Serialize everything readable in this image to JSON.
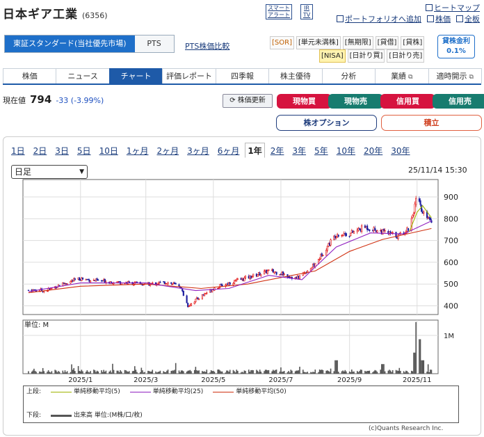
{
  "header": {
    "company_name": "日本ギア工業",
    "code": "(6356)",
    "smart_alert_1": "スマート",
    "smart_alert_2": "アラート",
    "ir_1": "IR",
    "ir_2": "TV",
    "heatmap": "ヒートマップ",
    "portfolio_add": "ポートフォリオへ追加",
    "stock_price": "株価",
    "full_board": "全板"
  },
  "market_tabs": [
    "東証スタンダード(当社優先市場)",
    "PTS"
  ],
  "pts_compare": "PTS株価比較",
  "tags_row1": [
    "[SOR]",
    "[単元未満株]",
    "[無期限]",
    "[貸借]",
    "[貸株]"
  ],
  "tags_row2": [
    "[NISA]",
    "[日計り買]",
    "[日計り売]"
  ],
  "lending": {
    "label": "貸株金利",
    "rate": "0.1%"
  },
  "nav": [
    "株価",
    "ニュース",
    "チャート",
    "評価レポート",
    "四季報",
    "株主優待",
    "分析",
    "業績",
    "適時開示"
  ],
  "price": {
    "label": "現在値",
    "value": "794",
    "change": "-33 (-3.99%)"
  },
  "buttons": {
    "refresh": "株価更新",
    "buy": "現物買",
    "sell": "現物売",
    "margin_buy": "信用買",
    "margin_sell": "信用売",
    "option": "株オプション",
    "accumulate": "積立"
  },
  "periods": [
    "1日",
    "2日",
    "3日",
    "5日",
    "10日",
    "1ヶ月",
    "2ヶ月",
    "3ヶ月",
    "6ヶ月",
    "1年",
    "2年",
    "3年",
    "5年",
    "10年",
    "20年",
    "30年"
  ],
  "select_value": "日足",
  "timestamp": "25/11/14 15:30",
  "legend": {
    "upper_label": "上段:",
    "ma5": "単純移動平均(5)",
    "ma25": "単純移動平均(25)",
    "ma50": "単純移動平均(50)",
    "lower_label": "下段:",
    "volume": "出来高 単位:(M株/口/枚)"
  },
  "credit": "(c)Quants Research Inc.",
  "colors": {
    "ma5": "#9fb400",
    "ma25": "#9020c0",
    "ma50": "#d03010",
    "up": "#e00000",
    "down": "#2020a0",
    "accent": "#1e6fc9"
  },
  "chart_data": {
    "type": "candlestick",
    "price_axis": {
      "ticks": [
        400,
        500,
        600,
        700,
        800,
        900
      ],
      "ylim": [
        360,
        980
      ]
    },
    "volume_axis": {
      "unit_label": "単位: M",
      "ticks": [
        "1M"
      ],
      "ylim": [
        0,
        1.4
      ]
    },
    "x_ticks": [
      "2025/1",
      "2025/3",
      "2025/5",
      "2025/7",
      "2025/9",
      "2025/11"
    ],
    "close_points": [
      [
        "2024-11-15",
        472
      ],
      [
        "2024-12-01",
        470
      ],
      [
        "2024-12-15",
        500
      ],
      [
        "2025-01-01",
        525
      ],
      [
        "2025-01-15",
        515
      ],
      [
        "2025-02-01",
        510
      ],
      [
        "2025-02-15",
        505
      ],
      [
        "2025-03-01",
        498
      ],
      [
        "2025-03-20",
        508
      ],
      [
        "2025-04-01",
        490
      ],
      [
        "2025-04-08",
        400
      ],
      [
        "2025-04-20",
        445
      ],
      [
        "2025-05-01",
        480
      ],
      [
        "2025-05-20",
        512
      ],
      [
        "2025-06-01",
        530
      ],
      [
        "2025-06-20",
        560
      ],
      [
        "2025-07-01",
        550
      ],
      [
        "2025-07-15",
        525
      ],
      [
        "2025-08-01",
        590
      ],
      [
        "2025-08-10",
        660
      ],
      [
        "2025-08-20",
        730
      ],
      [
        "2025-09-01",
        730
      ],
      [
        "2025-09-15",
        762
      ],
      [
        "2025-10-01",
        740
      ],
      [
        "2025-10-15",
        720
      ],
      [
        "2025-10-25",
        760
      ],
      [
        "2025-11-01",
        900
      ],
      [
        "2025-11-06",
        820
      ],
      [
        "2025-11-10",
        815
      ],
      [
        "2025-11-14",
        794
      ]
    ],
    "ma5": [
      [
        "2025-10-25",
        740
      ],
      [
        "2025-11-01",
        830
      ],
      [
        "2025-11-06",
        860
      ],
      [
        "2025-11-14",
        805
      ]
    ],
    "ma25": [
      [
        "2024-11-15",
        465
      ],
      [
        "2025-01-01",
        505
      ],
      [
        "2025-03-01",
        505
      ],
      [
        "2025-04-15",
        470
      ],
      [
        "2025-05-15",
        480
      ],
      [
        "2025-06-20",
        540
      ],
      [
        "2025-07-20",
        520
      ],
      [
        "2025-08-20",
        670
      ],
      [
        "2025-09-20",
        735
      ],
      [
        "2025-10-20",
        730
      ],
      [
        "2025-11-14",
        790
      ]
    ],
    "ma50": [
      [
        "2024-11-15",
        460
      ],
      [
        "2025-01-01",
        490
      ],
      [
        "2025-03-01",
        500
      ],
      [
        "2025-04-20",
        480
      ],
      [
        "2025-06-01",
        500
      ],
      [
        "2025-07-01",
        530
      ],
      [
        "2025-08-01",
        560
      ],
      [
        "2025-09-01",
        650
      ],
      [
        "2025-10-01",
        705
      ],
      [
        "2025-11-14",
        755
      ]
    ],
    "volume_spikes": [
      [
        "2025-08-20",
        0.35
      ],
      [
        "2025-10-01",
        0.25
      ],
      [
        "2025-10-30",
        0.55
      ],
      [
        "2025-11-01",
        1.35
      ],
      [
        "2025-11-03",
        0.9
      ],
      [
        "2025-11-06",
        0.35
      ]
    ]
  }
}
